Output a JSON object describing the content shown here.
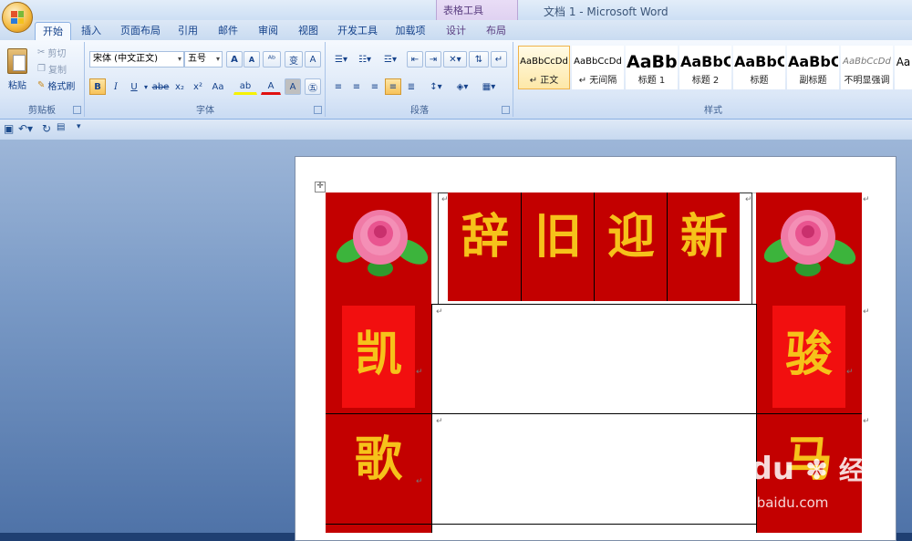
{
  "window": {
    "title": "文档 1 - Microsoft Word",
    "context_group": "表格工具"
  },
  "tabs": [
    {
      "label": "开始",
      "active": true
    },
    {
      "label": "插入"
    },
    {
      "label": "页面布局"
    },
    {
      "label": "引用"
    },
    {
      "label": "邮件"
    },
    {
      "label": "审阅"
    },
    {
      "label": "视图"
    },
    {
      "label": "开发工具"
    },
    {
      "label": "加载项"
    },
    {
      "label": "设计"
    },
    {
      "label": "布局"
    }
  ],
  "ribbon": {
    "clipboard": {
      "paste": "粘贴",
      "cut": "剪切",
      "copy": "复制",
      "format_painter": "格式刷",
      "label": "剪贴板"
    },
    "font": {
      "name": "宋体 (中文正文)",
      "size": "五号",
      "label": "字体",
      "bold": "B",
      "italic": "I",
      "underline": "U",
      "strike": "abe",
      "sub": "x₂",
      "sup": "x²",
      "case": "Aa",
      "grow": "A",
      "shrink": "A",
      "highlight": "ab",
      "color": "A",
      "char_border": "A",
      "char_shade": "A"
    },
    "paragraph": {
      "label": "段落"
    },
    "styles": {
      "label": "样式",
      "tiles": [
        {
          "sample": "AaBbCcDd",
          "name": "↵ 正文",
          "selected": true
        },
        {
          "sample": "AaBbCcDd",
          "name": "↵ 无间隔"
        },
        {
          "sample": "AaBb",
          "name": "标题 1"
        },
        {
          "sample": "AaBbC",
          "name": "标题 2"
        },
        {
          "sample": "AaBbC",
          "name": "标题"
        },
        {
          "sample": "AaBbC",
          "name": "副标题"
        },
        {
          "sample": "AaBbCcDd",
          "name": "不明显强调"
        },
        {
          "sample": "Aa",
          "name": ""
        }
      ]
    }
  },
  "document": {
    "header_chars": [
      "辞",
      "旧",
      "迎",
      "新"
    ],
    "left_chars": [
      "凯",
      "歌"
    ],
    "right_chars": [
      "骏",
      "马"
    ],
    "colors": {
      "red_dark": "#c30000",
      "red_light": "#f20f0f",
      "gold": "#f6c21a"
    }
  },
  "watermark": {
    "brand": "Baidu",
    "brand_cn": "经验",
    "url": "jingyan.baidu.com"
  }
}
